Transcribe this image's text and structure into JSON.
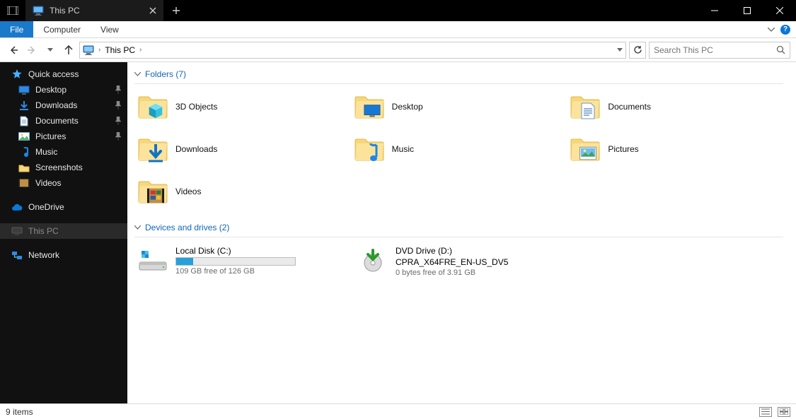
{
  "titlebar": {
    "tab_title": "This PC"
  },
  "ribbon": {
    "file": "File",
    "menu": [
      "Computer",
      "View"
    ]
  },
  "address": {
    "crumb": "This PC",
    "search_placeholder": "Search This PC"
  },
  "sidebar": {
    "quick_access": "Quick access",
    "quick_items": [
      {
        "label": "Desktop",
        "pinned": true,
        "icon": "desktop"
      },
      {
        "label": "Downloads",
        "pinned": true,
        "icon": "downloads"
      },
      {
        "label": "Documents",
        "pinned": true,
        "icon": "documents"
      },
      {
        "label": "Pictures",
        "pinned": true,
        "icon": "pictures"
      },
      {
        "label": "Music",
        "pinned": false,
        "icon": "music"
      },
      {
        "label": "Screenshots",
        "pinned": false,
        "icon": "folder"
      },
      {
        "label": "Videos",
        "pinned": false,
        "icon": "videos"
      }
    ],
    "onedrive": "OneDrive",
    "thispc": "This PC",
    "network": "Network"
  },
  "content": {
    "folders_header": "Folders (7)",
    "folders": [
      {
        "label": "3D Objects",
        "icon": "3d"
      },
      {
        "label": "Desktop",
        "icon": "desktop"
      },
      {
        "label": "Documents",
        "icon": "documents"
      },
      {
        "label": "Downloads",
        "icon": "downloads"
      },
      {
        "label": "Music",
        "icon": "music"
      },
      {
        "label": "Pictures",
        "icon": "pictures"
      },
      {
        "label": "Videos",
        "icon": "videos"
      }
    ],
    "drives_header": "Devices and drives (2)",
    "drives": [
      {
        "name": "Local Disk (C:)",
        "sub": "109 GB free of 126 GB",
        "fill": 0.14,
        "icon": "hdd",
        "bar": true
      },
      {
        "name": "DVD Drive (D:)",
        "label2": "CPRA_X64FRE_EN-US_DV5",
        "sub": "0 bytes free of 3.91 GB",
        "icon": "dvd",
        "bar": false
      }
    ]
  },
  "statusbar": {
    "count": "9 items"
  }
}
